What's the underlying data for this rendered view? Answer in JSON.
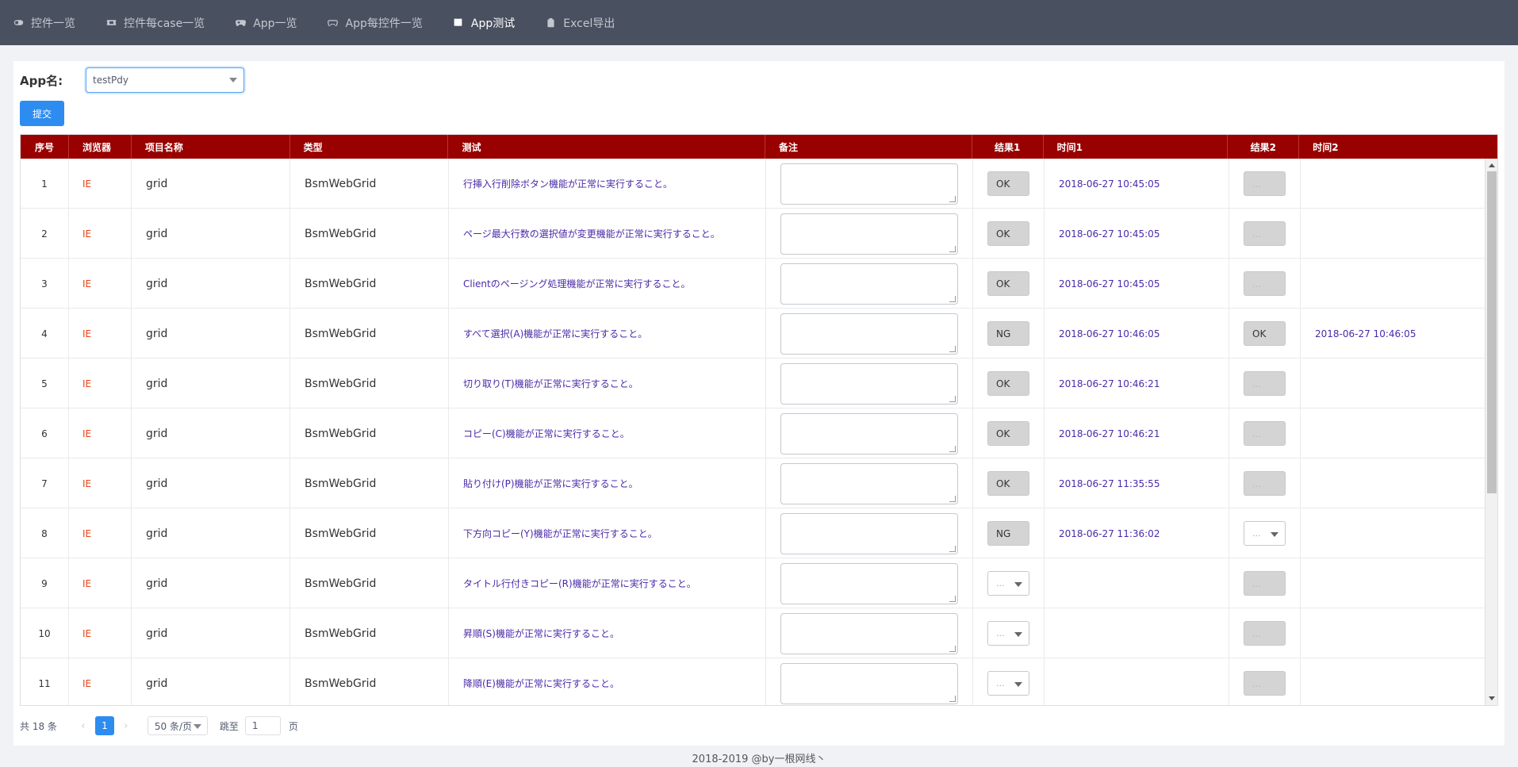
{
  "nav": {
    "items": [
      {
        "label": "控件一览",
        "icon": "toggle-icon"
      },
      {
        "label": "控件每case一览",
        "icon": "ticket-icon"
      },
      {
        "label": "App一览",
        "icon": "gamepad-icon"
      },
      {
        "label": "App每控件一览",
        "icon": "gamepad-outline-icon"
      },
      {
        "label": "App测试",
        "icon": "book-icon"
      },
      {
        "label": "Excel导出",
        "icon": "clipboard-icon"
      }
    ],
    "active_index": 4
  },
  "form": {
    "app_label": "App名:",
    "app_value": "testPdy",
    "submit_label": "提交"
  },
  "table": {
    "headers": {
      "num": "序号",
      "browser": "浏览器",
      "project": "项目名称",
      "type": "类型",
      "test": "测试",
      "note": "备注",
      "result1": "结果1",
      "time1": "时间1",
      "result2": "结果2",
      "time2": "时间2"
    },
    "rows": [
      {
        "num": "1",
        "browser": "IE",
        "project": "grid",
        "type": "BsmWebGrid",
        "test": "行挿入行削除ボタン機能が正常に実行すること。",
        "result1": "OK",
        "time1": "2018-06-27 10:45:05",
        "result2": "...",
        "time2": ""
      },
      {
        "num": "2",
        "browser": "IE",
        "project": "grid",
        "type": "BsmWebGrid",
        "test": "ページ最大行数の選択値が変更機能が正常に実行すること。",
        "result1": "OK",
        "time1": "2018-06-27 10:45:05",
        "result2": "...",
        "time2": ""
      },
      {
        "num": "3",
        "browser": "IE",
        "project": "grid",
        "type": "BsmWebGrid",
        "test": "Clientのページング処理機能が正常に実行すること。",
        "result1": "OK",
        "time1": "2018-06-27 10:45:05",
        "result2": "...",
        "time2": ""
      },
      {
        "num": "4",
        "browser": "IE",
        "project": "grid",
        "type": "BsmWebGrid",
        "test": "すべて選択(A)機能が正常に実行すること。",
        "result1": "NG",
        "time1": "2018-06-27 10:46:05",
        "result2": "OK",
        "time2": "2018-06-27 10:46:05"
      },
      {
        "num": "5",
        "browser": "IE",
        "project": "grid",
        "type": "BsmWebGrid",
        "test": "切り取り(T)機能が正常に実行すること。",
        "result1": "OK",
        "time1": "2018-06-27 10:46:21",
        "result2": "...",
        "time2": ""
      },
      {
        "num": "6",
        "browser": "IE",
        "project": "grid",
        "type": "BsmWebGrid",
        "test": "コピー(C)機能が正常に実行すること。",
        "result1": "OK",
        "time1": "2018-06-27 10:46:21",
        "result2": "...",
        "time2": ""
      },
      {
        "num": "7",
        "browser": "IE",
        "project": "grid",
        "type": "BsmWebGrid",
        "test": "貼り付け(P)機能が正常に実行すること。",
        "result1": "OK",
        "time1": "2018-06-27 11:35:55",
        "result2": "...",
        "time2": ""
      },
      {
        "num": "8",
        "browser": "IE",
        "project": "grid",
        "type": "BsmWebGrid",
        "test": "下方向コピー(Y)機能が正常に実行すること。",
        "result1": "NG",
        "time1": "2018-06-27 11:36:02",
        "result2": "...",
        "time2": ""
      },
      {
        "num": "9",
        "browser": "IE",
        "project": "grid",
        "type": "BsmWebGrid",
        "test": "タイトル行付きコピー(R)機能が正常に実行すること。",
        "result1": "...",
        "time1": "",
        "result2": "...",
        "time2": ""
      },
      {
        "num": "10",
        "browser": "IE",
        "project": "grid",
        "type": "BsmWebGrid",
        "test": "昇順(S)機能が正常に実行すること。",
        "result1": "...",
        "time1": "",
        "result2": "...",
        "time2": ""
      },
      {
        "num": "11",
        "browser": "IE",
        "project": "grid",
        "type": "BsmWebGrid",
        "test": "降順(E)機能が正常に実行すること。",
        "result1": "...",
        "time1": "",
        "result2": "...",
        "time2": ""
      }
    ]
  },
  "pager": {
    "total": "共 18 条",
    "prev": "‹",
    "current_page": "1",
    "next": "›",
    "page_size": "50 条/页",
    "jump_label": "跳至",
    "jump_value": "1",
    "page_suffix": "页"
  },
  "footer": {
    "text": "2018-2019 @by一根网线丶"
  },
  "colors": {
    "nav_bg": "#495060",
    "header_bg": "#990000",
    "primary": "#2d8cf0",
    "browser_text": "#ed3f14",
    "test_text": "#4b2aa8"
  }
}
